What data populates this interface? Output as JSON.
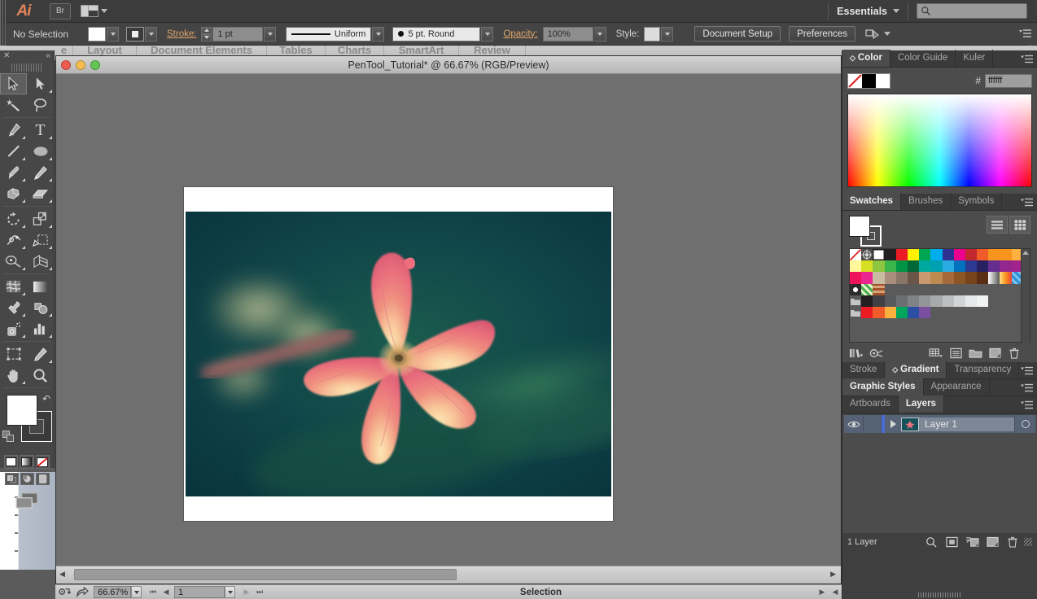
{
  "app": {
    "name": "Adobe Illustrator",
    "logo_text": "Ai",
    "bridge_label": "Br",
    "workspace": "Essentials",
    "search_placeholder": ""
  },
  "control_bar": {
    "selection_status": "No Selection",
    "stroke_label": "Stroke:",
    "stroke_weight": "1 pt",
    "stroke_profile": "Uniform",
    "brush_definition": "5 pt. Round",
    "opacity_label": "Opacity:",
    "opacity_value": "100%",
    "style_label": "Style:",
    "document_setup_button": "Document Setup",
    "preferences_button": "Preferences"
  },
  "background_window": {
    "ribbon_tabs": [
      "e",
      "Layout",
      "Document Elements",
      "Tables",
      "Charts",
      "SmartArt",
      "Review"
    ]
  },
  "document": {
    "title": "PenTool_Tutorial* @ 66.67% (RGB/Preview)",
    "file_name": "PenTool_Tutorial*",
    "zoom": "66.67%",
    "color_mode": "RGB/Preview",
    "artwork_alt": "Pink plumeria flower photograph on dark teal-green background"
  },
  "status_bar": {
    "zoom_value": "66.67%",
    "page_number": "1",
    "status_text": "Selection"
  },
  "tools": {
    "items": [
      {
        "name": "selection-tool",
        "glyph": "arrow",
        "selected": true
      },
      {
        "name": "direct-selection-tool",
        "glyph": "arrow-white",
        "selected": false
      },
      {
        "name": "magic-wand-tool",
        "glyph": "wand",
        "selected": false
      },
      {
        "name": "lasso-tool",
        "glyph": "lasso",
        "selected": false
      },
      {
        "name": "pen-tool",
        "glyph": "pen",
        "selected": false
      },
      {
        "name": "type-tool",
        "glyph": "T",
        "selected": false
      },
      {
        "name": "line-segment-tool",
        "glyph": "line",
        "selected": false
      },
      {
        "name": "ellipse-tool",
        "glyph": "ellipse",
        "selected": false
      },
      {
        "name": "paintbrush-tool",
        "glyph": "brush",
        "selected": false
      },
      {
        "name": "pencil-tool",
        "glyph": "pencil",
        "selected": false
      },
      {
        "name": "blob-brush-tool",
        "glyph": "blob",
        "selected": false
      },
      {
        "name": "eraser-tool",
        "glyph": "eraser",
        "selected": false
      },
      {
        "name": "rotate-tool",
        "glyph": "rotate",
        "selected": false
      },
      {
        "name": "scale-tool",
        "glyph": "scale",
        "selected": false
      },
      {
        "name": "width-tool",
        "glyph": "width",
        "selected": false
      },
      {
        "name": "free-transform-tool",
        "glyph": "transform",
        "selected": false
      },
      {
        "name": "shape-builder-tool",
        "glyph": "shapebuilder",
        "selected": false
      },
      {
        "name": "perspective-grid-tool",
        "glyph": "perspective",
        "selected": false
      },
      {
        "name": "mesh-tool",
        "glyph": "mesh",
        "selected": false
      },
      {
        "name": "gradient-tool",
        "glyph": "gradient",
        "selected": false
      },
      {
        "name": "eyedropper-tool",
        "glyph": "eyedropper",
        "selected": false
      },
      {
        "name": "blend-tool",
        "glyph": "blend",
        "selected": false
      },
      {
        "name": "symbol-sprayer-tool",
        "glyph": "sprayer",
        "selected": false
      },
      {
        "name": "column-graph-tool",
        "glyph": "graph",
        "selected": false
      },
      {
        "name": "artboard-tool",
        "glyph": "artboard",
        "selected": false
      },
      {
        "name": "slice-tool",
        "glyph": "slice",
        "selected": false
      },
      {
        "name": "hand-tool",
        "glyph": "hand",
        "selected": false
      },
      {
        "name": "zoom-tool",
        "glyph": "zoom",
        "selected": false
      }
    ],
    "fill_color": "#ffffff",
    "stroke_color": "#3a3a3a",
    "fill_stroke_modes": [
      "color",
      "gradient",
      "none"
    ],
    "draw_modes": [
      "draw-normal",
      "draw-behind",
      "draw-inside"
    ]
  },
  "panels": {
    "color": {
      "tabs": [
        "Color",
        "Color Guide",
        "Kuler"
      ],
      "active_tab": "Color",
      "hex_label": "#",
      "hex_value": "ffffff",
      "fill_swatch": "#000000",
      "stroke_swatch": "#ffffff"
    },
    "swatches": {
      "tabs": [
        "Swatches",
        "Brushes",
        "Symbols"
      ],
      "active_tab": "Swatches",
      "fill_color": "#ffffff",
      "rows": [
        [
          "none",
          "registration",
          "#ffffff",
          "#231f20",
          "#ed1c24",
          "#fff200",
          "#00a651",
          "#00aeef",
          "#2e3192",
          "#ec008c",
          "#c1272d",
          "#f15a29",
          "#f7941e",
          "#f7941e",
          "#fbb040"
        ],
        [
          "#fff79a",
          "#d7df23",
          "#8dc63f",
          "#39b54a",
          "#009444",
          "#006838",
          "#00a99d",
          "#00a0b0",
          "#29abe2",
          "#0071bc",
          "#2b3990",
          "#262262",
          "#662d91",
          "#92278f",
          "#a3238e"
        ],
        [
          "#ed145b",
          "#ec268f",
          "#c9bda1",
          "#a98e7e",
          "#8a7668",
          "#6b5548",
          "#c99a6e",
          "#bd8a4f",
          "#a5693a",
          "#8b5524",
          "#77431b",
          "#5a2e14",
          "gradient-white",
          "gradient-orange",
          "pattern-blue"
        ],
        [
          "pattern-dot",
          "pattern-leaf",
          "pattern-brick"
        ],
        [
          "folder",
          "#231f20",
          "#414042",
          "#58595b",
          "#6d6e71",
          "#808285",
          "#939598",
          "#a7a9ac",
          "#bcbec0",
          "#d1d3d4",
          "#e6e7e8",
          "#f1f2f2"
        ],
        [
          "folder",
          "#ed1c24",
          "#f15a29",
          "#fbb040",
          "#00a65d",
          "#2b4fa2",
          "#7b4fa0"
        ]
      ],
      "view_modes": [
        "list-view",
        "grid-view"
      ],
      "footer_buttons": [
        "swatch-libraries",
        "color-groups",
        "show-kinds",
        "swatch-options",
        "new-color-group",
        "new-swatch",
        "delete-swatch"
      ]
    },
    "stroke_group": {
      "tabs": [
        "Stroke",
        "Gradient",
        "Transparency"
      ],
      "active_tab": "Gradient"
    },
    "styles_group": {
      "tabs": [
        "Graphic Styles",
        "Appearance"
      ],
      "active_tab": "Graphic Styles"
    },
    "layers_group": {
      "tabs": [
        "Artboards",
        "Layers"
      ],
      "active_tab": "Layers",
      "rows": [
        {
          "name": "Layer 1",
          "visible": true,
          "locked": false,
          "expanded": false
        }
      ],
      "footer_count": "1 Layer",
      "footer_buttons": [
        "locate-object",
        "make-clipping-mask",
        "create-new-sublayer",
        "create-new-layer",
        "delete-selection"
      ]
    }
  },
  "colors": {
    "accent_orange": "#e0a56a",
    "panel_bg": "#4c4c4c",
    "dock_bg": "#3f3f3f",
    "chrome_bg": "#3c3c3c",
    "canvas_bg": "#6f6f6f",
    "layer_row_bg": "#566275",
    "photo_bg": "#0d3b42"
  }
}
